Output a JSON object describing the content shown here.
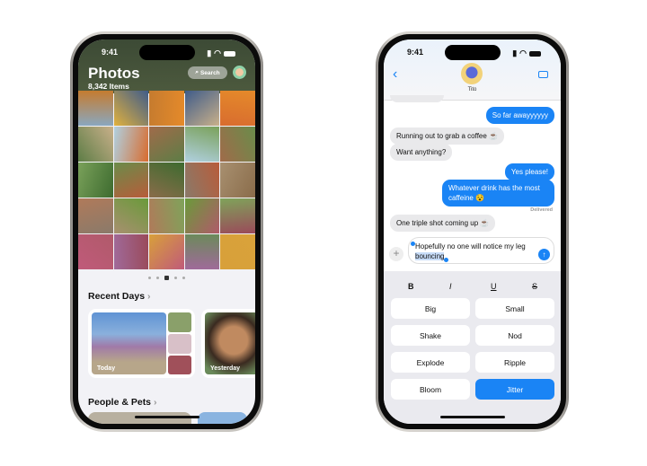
{
  "status": {
    "time": "9:41"
  },
  "photos": {
    "title": "Photos",
    "count": "8,342 Items",
    "search_label": "Search",
    "tiles": [
      "#6b8a5a",
      "#d9a23a",
      "#4d6b3a",
      "#c48a63",
      "#7fa9c9",
      "#8aa7bf",
      "#e0b13e",
      "#c57b2f",
      "#3f5c8a",
      "#e58a2a",
      "#c9b08a",
      "#d86c2f",
      "#5d7d46",
      "#b0d0e0",
      "#a06b4a",
      "#7aa15a",
      "#6a8c4a",
      "#3d6b2f",
      "#b85c3a",
      "#8a6c4a",
      "#8a7a6a",
      "#a89070",
      "#b07a5a",
      "#6a9a3a",
      "#7fa35a",
      "#b05a6a",
      "#9a4a5a",
      "#c05a7a",
      "#a06a9a",
      "#d8a03a"
    ],
    "recent_days": "Recent Days",
    "people_pets": "People & Pets",
    "cards": [
      {
        "label": "Today"
      },
      {
        "label": "Yesterday"
      }
    ]
  },
  "messages": {
    "contact": "Tito",
    "thread": [
      {
        "from": "out",
        "text": "So far awayyyyyy"
      },
      {
        "from": "in",
        "text": "Running out to grab a coffee ☕"
      },
      {
        "from": "in",
        "text": "Want anything?"
      },
      {
        "from": "out",
        "text": "Yes please!"
      },
      {
        "from": "out",
        "text": "Whatever drink has the most caffeine 😵"
      },
      {
        "from": "in",
        "text": "One triple shot coming up ☕"
      }
    ],
    "delivered": "Delivered",
    "draft_before": "Hopefully no one will notice my leg ",
    "draft_selected": "bouncing",
    "styles": [
      "B",
      "I",
      "U",
      "S"
    ],
    "effects": [
      "Big",
      "Small",
      "Shake",
      "Nod",
      "Explode",
      "Ripple",
      "Bloom",
      "Jitter"
    ],
    "selected_effect": "Jitter",
    "accent": "#1a84f5"
  }
}
